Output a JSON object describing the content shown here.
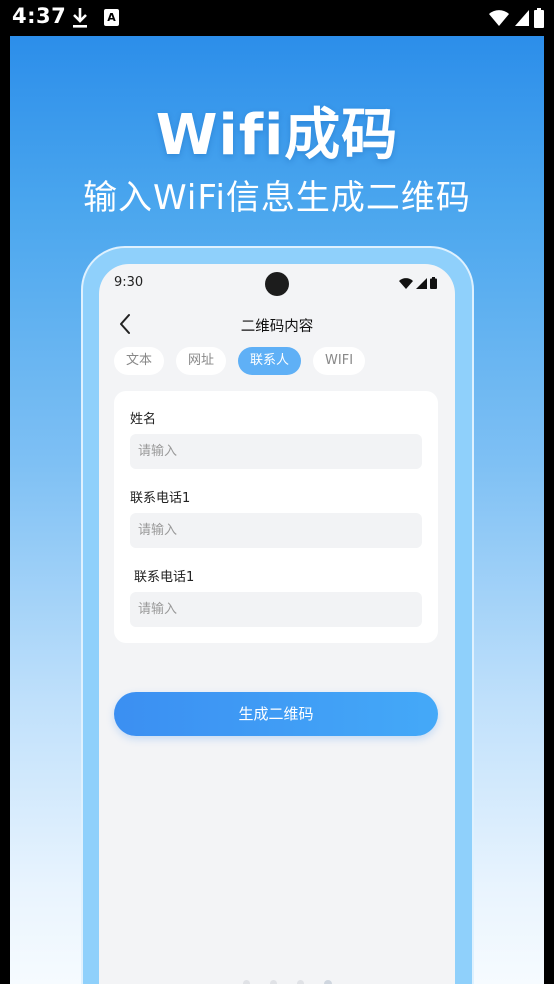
{
  "status_bar": {
    "time": "4:37"
  },
  "hero": {
    "title": "Wifi成码",
    "subtitle": "输入WiFi信息生成二维码"
  },
  "phone": {
    "status_time": "9:30",
    "heading": "二维码内容",
    "tabs": [
      {
        "label": "文本",
        "active": false
      },
      {
        "label": "网址",
        "active": false
      },
      {
        "label": "联系人",
        "active": true
      },
      {
        "label": "WIFI",
        "active": false
      }
    ],
    "form": {
      "fields": [
        {
          "label": "姓名",
          "placeholder": "请输入",
          "value": ""
        },
        {
          "label": "联系电话1",
          "placeholder": "请输入",
          "value": ""
        },
        {
          "label": "联系电话1",
          "placeholder": "请输入",
          "value": ""
        }
      ]
    },
    "generate_button": "生成二维码",
    "page_indicator": {
      "count": 4,
      "active_index": 3
    }
  },
  "colors": {
    "accent": "#5fb0f6",
    "button": "#3b8ff2",
    "background_top": "#2c8eea"
  }
}
